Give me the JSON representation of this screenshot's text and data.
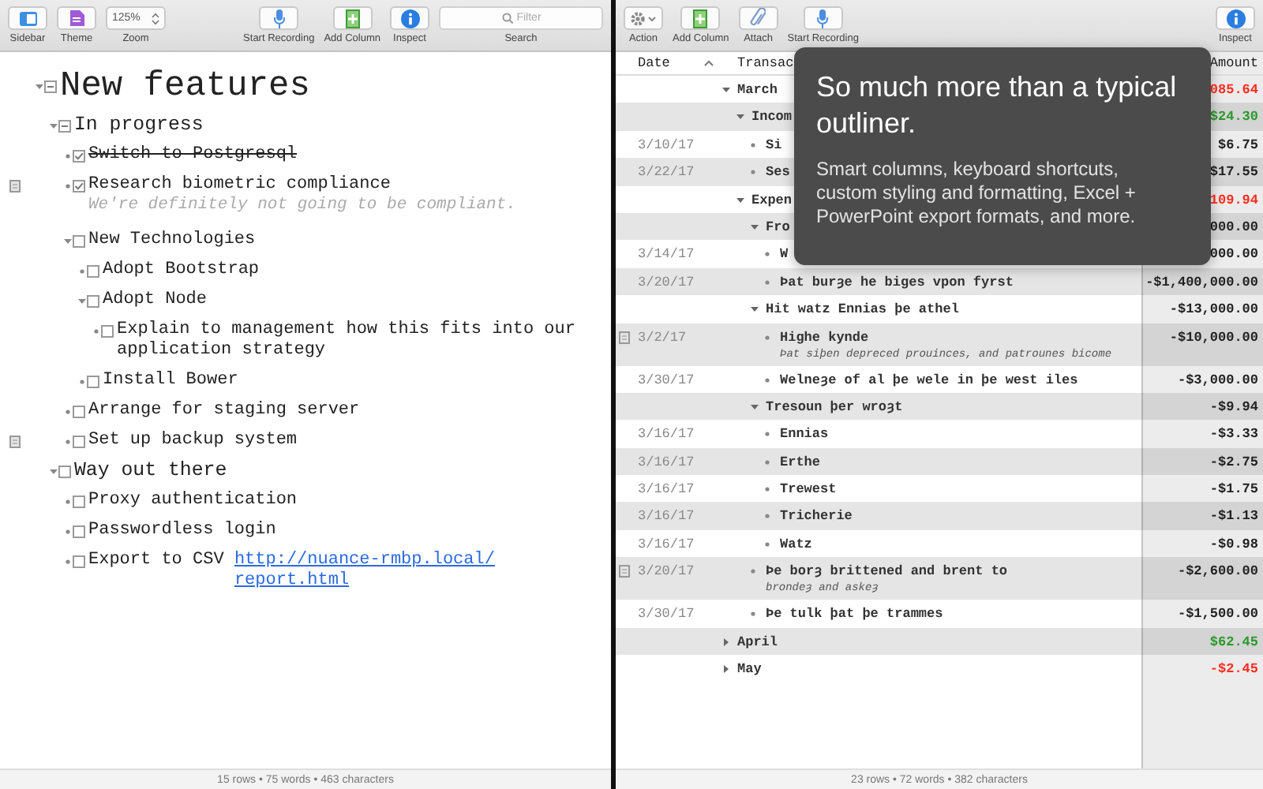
{
  "left_pane": {
    "toolbar": {
      "groups": [
        [
          {
            "kind": "sidebar",
            "label": "Sidebar"
          },
          {
            "kind": "theme",
            "label": "Theme"
          },
          {
            "kind": "zoom",
            "value": "125%",
            "label": "Zoom"
          }
        ],
        [
          {
            "kind": "mic",
            "label": "Start Recording"
          },
          {
            "kind": "add-column",
            "label": "Add Column"
          },
          {
            "kind": "inspect",
            "label": "Inspect"
          },
          {
            "kind": "search",
            "placeholder": "Filter",
            "label": "Search"
          }
        ]
      ]
    },
    "outline": [
      {
        "text": "New features",
        "checked": false,
        "mixed": true,
        "struck": false,
        "note_icon": false,
        "expanded": true,
        "children": [
          {
            "text": "In progress",
            "checked": false,
            "mixed": true,
            "struck": false,
            "note_icon": false,
            "expanded": true,
            "children": [
              {
                "text": "Switch to Postgresql",
                "checked": true,
                "mixed": false,
                "struck": true,
                "note_icon": false
              },
              {
                "text": "Research biometric compliance",
                "checked": true,
                "mixed": false,
                "struck": false,
                "note_icon": true,
                "note": "We're definitely not going to be compliant."
              },
              {
                "text": "New Technologies",
                "checked": false,
                "mixed": false,
                "struck": false,
                "note_icon": false,
                "expanded": true,
                "children": [
                  {
                    "text": "Adopt Bootstrap",
                    "checked": false,
                    "mixed": false,
                    "struck": false,
                    "note_icon": false
                  },
                  {
                    "text": "Adopt Node",
                    "checked": false,
                    "mixed": false,
                    "struck": false,
                    "note_icon": false,
                    "expanded": true,
                    "children": [
                      {
                        "text": "Explain to management how this fits into our application strategy",
                        "checked": false,
                        "mixed": false,
                        "struck": false,
                        "note_icon": false
                      }
                    ]
                  },
                  {
                    "text": "Install Bower",
                    "checked": false,
                    "mixed": false,
                    "struck": false,
                    "note_icon": false
                  }
                ]
              },
              {
                "text": "Arrange for staging server",
                "checked": false,
                "mixed": false,
                "struck": false,
                "note_icon": false
              },
              {
                "text": "Set up backup system",
                "checked": false,
                "mixed": false,
                "struck": false,
                "note_icon": true
              }
            ]
          },
          {
            "text": "Way out there",
            "checked": false,
            "mixed": false,
            "struck": false,
            "note_icon": false,
            "expanded": true,
            "children": [
              {
                "text": "Proxy authentication",
                "checked": false,
                "mixed": false,
                "struck": false,
                "note_icon": false
              },
              {
                "text": "Passwordless login",
                "checked": false,
                "mixed": false,
                "struck": false,
                "note_icon": false
              },
              {
                "text": "Export to CSV",
                "link": "http://nuance-rmbp.local/report.html",
                "checked": false,
                "mixed": false,
                "struck": false,
                "note_icon": false
              }
            ]
          }
        ]
      }
    ],
    "status_bar": "15 rows • 75 words • 463 characters"
  },
  "right_pane": {
    "toolbar": {
      "groups": [
        [
          {
            "kind": "action",
            "label": "Action"
          },
          {
            "kind": "add-column",
            "label": "Add Column"
          },
          {
            "kind": "attach",
            "label": "Attach"
          },
          {
            "kind": "mic",
            "label": "Start Recording"
          }
        ],
        [
          {
            "kind": "inspect",
            "label": "Inspect"
          }
        ]
      ]
    },
    "table": {
      "columns": [
        "Date",
        "Transac",
        "Amount"
      ],
      "rows": [
        {
          "text": "March",
          "amount": "085.64",
          "color": "#ff2d20",
          "expanded": true,
          "children": [
            {
              "text": "Incom",
              "amount": "$24.30",
              "color": "#2a9a2a",
              "expanded": true,
              "children": [
                {
                  "date": "3/10/17",
                  "text": "Si",
                  "amount": "$6.75",
                  "color": "#222222"
                },
                {
                  "date": "3/22/17",
                  "text": "Ses",
                  "amount": "$17.55",
                  "color": "#222222"
                }
              ]
            },
            {
              "text": "Expen",
              "amount": "109.94",
              "color": "#ff2d20",
              "expanded": true,
              "children": [
                {
                  "text": "Fro",
                  "amount": "000.00",
                  "color": "#222222",
                  "expanded": true,
                  "children": [
                    {
                      "date": "3/14/17",
                      "text": "W",
                      "amount": "000.00",
                      "color": "#222222"
                    },
                    {
                      "date": "3/20/17",
                      "text": "Þat burȝe he biges vpon fyrst",
                      "amount": "-$1,400,000.00",
                      "color": "#222222"
                    }
                  ]
                },
                {
                  "text": "Hit watz Ennias þe athel",
                  "amount": "-$13,000.00",
                  "color": "#222222",
                  "expanded": true,
                  "children": [
                    {
                      "date": "3/2/17",
                      "text": "Highe kynde",
                      "note": "Þat siþen depreced prouinces, and patrounes bicome",
                      "amount": "-$10,000.00",
                      "color": "#222222"
                    },
                    {
                      "date": "3/30/17",
                      "text": "Welneȝe of al þe wele in þe west iles",
                      "amount": "-$3,000.00",
                      "color": "#222222"
                    }
                  ]
                },
                {
                  "text": "Tresoun þer wroȝt",
                  "amount": "-$9.94",
                  "color": "#222222",
                  "expanded": true,
                  "children": [
                    {
                      "date": "3/16/17",
                      "text": "Ennias",
                      "amount": "-$3.33",
                      "color": "#222222"
                    },
                    {
                      "date": "3/16/17",
                      "text": "Erthe",
                      "amount": "-$2.75",
                      "color": "#222222"
                    },
                    {
                      "date": "3/16/17",
                      "text": "Trewest",
                      "amount": "-$1.75",
                      "color": "#222222"
                    },
                    {
                      "date": "3/16/17",
                      "text": "Tricherie",
                      "amount": "-$1.13",
                      "color": "#222222"
                    },
                    {
                      "date": "3/16/17",
                      "text": "Watz",
                      "amount": "-$0.98",
                      "color": "#222222"
                    }
                  ]
                },
                {
                  "date": "3/20/17",
                  "text": "Þe borȝ brittened and brent to",
                  "note": "brondeȝ and askeȝ",
                  "amount": "-$2,600.00",
                  "color": "#222222"
                },
                {
                  "date": "3/30/17",
                  "text": "Þe tulk þat þe trammes",
                  "amount": "-$1,500.00",
                  "color": "#222222"
                }
              ]
            }
          ]
        },
        {
          "text": "April",
          "amount": "$62.45",
          "color": "#2a9a2a",
          "expanded": false
        },
        {
          "text": "May",
          "amount": "-$2.45",
          "color": "#ff2d20",
          "expanded": false
        }
      ]
    },
    "status_bar": "23 rows • 72 words • 382 characters"
  },
  "overlay": {
    "title": "So much more than a typical outliner.",
    "body": "Smart columns, keyboard shortcuts, custom styling and formatting, Excel + PowerPoint export formats, and more."
  }
}
